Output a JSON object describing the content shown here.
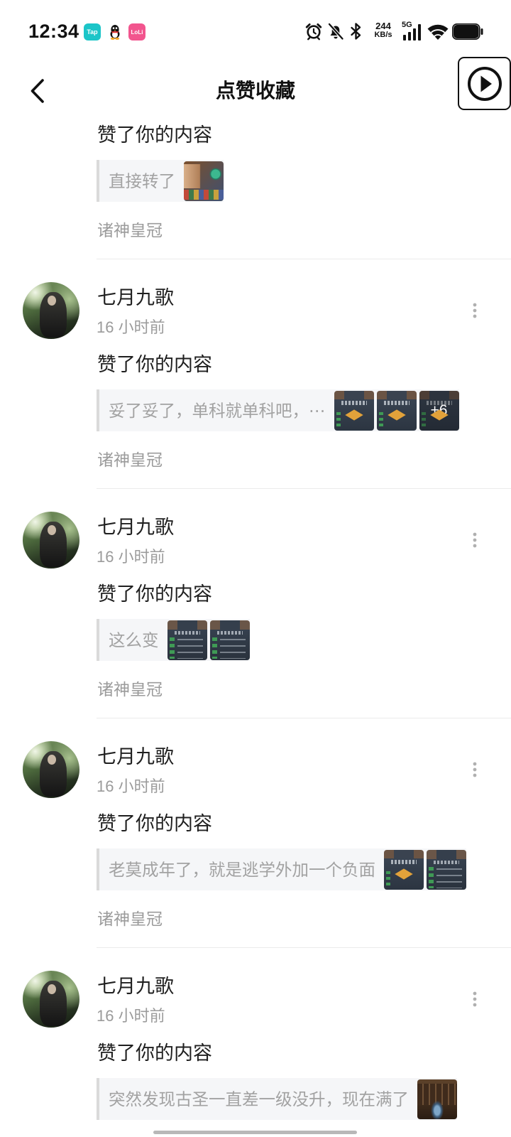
{
  "theme": {
    "text": "#1f1f1f",
    "muted": "#9b9b9b",
    "quote_text": "#a2a2a2",
    "quote_bg": "#f5f6f8",
    "quote_bar": "#dadada",
    "divider": "#ebebeb"
  },
  "status_bar": {
    "time": "12:34",
    "app_badges": [
      {
        "icon": "taptap-app-icon",
        "label": "Tap",
        "color": "#1cc5c8"
      },
      {
        "icon": "qq-app-icon"
      },
      {
        "icon": "loli-app-icon",
        "label": "LoLi",
        "color": "#f2558e"
      }
    ],
    "system_icons": [
      "alarm-icon",
      "bell-off-icon",
      "bluetooth-icon",
      "signal-icon",
      "wifi-icon",
      "battery-icon"
    ],
    "net_speed": {
      "value": "244",
      "unit": "KB/s"
    },
    "network_type": "5G",
    "signal_bars": 4,
    "battery_level": 1.0
  },
  "header": {
    "back_icon": "back-chevron-icon",
    "title": "点赞收藏",
    "action_icon": "play-circle-icon"
  },
  "notifications": [
    {
      "action": "赞了你的内容",
      "quote": "直接转了",
      "thumbs": [
        "card-thumb"
      ],
      "tag": "诸神皇冠"
    },
    {
      "user": {
        "name": "七月九歌"
      },
      "time": "16 小时前",
      "action": "赞了你的内容",
      "quote": "妥了妥了，单科就单科吧，⋯",
      "thumbs": [
        "map-thumb",
        "map-thumb",
        "map-thumb"
      ],
      "more_images": "+6",
      "tag": "诸神皇冠"
    },
    {
      "user": {
        "name": "七月九歌"
      },
      "time": "16 小时前",
      "action": "赞了你的内容",
      "quote": "这么变",
      "thumbs": [
        "list-thumb",
        "list-thumb"
      ],
      "tag": "诸神皇冠"
    },
    {
      "user": {
        "name": "七月九歌"
      },
      "time": "16 小时前",
      "action": "赞了你的内容",
      "quote": "老莫成年了，就是逃学外加一个负面",
      "thumbs": [
        "map-thumb",
        "list-thumb"
      ],
      "tag": "诸神皇冠"
    },
    {
      "user": {
        "name": "七月九歌"
      },
      "time": "16 小时前",
      "action": "赞了你的内容",
      "quote": "突然发现古圣一直差一级没升，现在满了",
      "thumbs": [
        "room-thumb"
      ]
    }
  ]
}
